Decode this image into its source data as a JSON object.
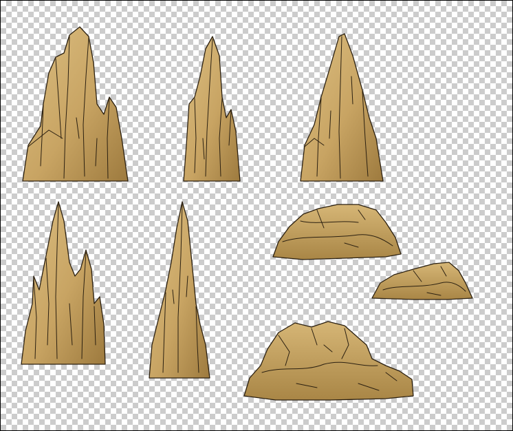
{
  "canvas": {
    "background": "transparency-checkerboard",
    "checker_light": "#ffffff",
    "checker_dark": "#cccccc"
  },
  "palette": {
    "rock_fill": "#c8a463",
    "rock_highlight": "#dcbf82",
    "rock_shadow": "#9d7a3e",
    "outline": "#2a1f10"
  },
  "sprites": [
    {
      "name": "rock-spire-cluster-large",
      "kind": "spire-cluster"
    },
    {
      "name": "rock-spire-tall-narrow",
      "kind": "spire"
    },
    {
      "name": "rock-spire-cone",
      "kind": "spire"
    },
    {
      "name": "rock-spire-cluster-jagged",
      "kind": "spire-cluster"
    },
    {
      "name": "rock-spire-needle",
      "kind": "spire"
    },
    {
      "name": "rock-boulder-flat",
      "kind": "boulder"
    },
    {
      "name": "rock-boulder-small",
      "kind": "boulder"
    },
    {
      "name": "rock-rubble-pile",
      "kind": "rubble"
    }
  ]
}
